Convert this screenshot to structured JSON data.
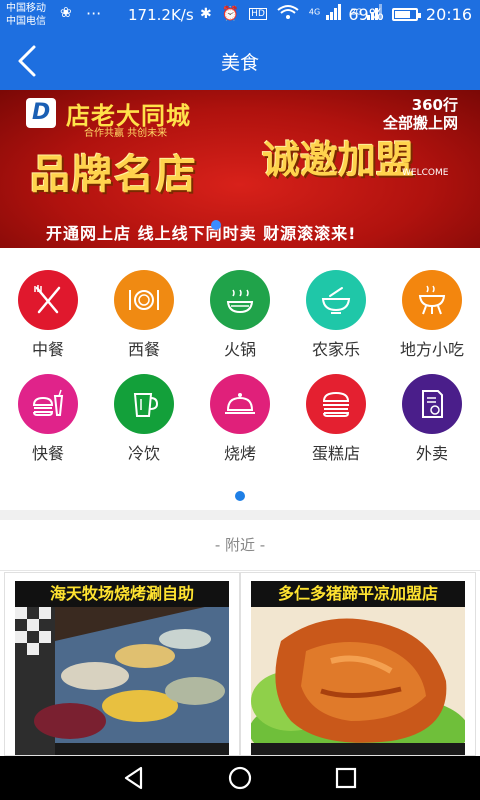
{
  "status_bar": {
    "carrier_1": "中国移动",
    "carrier_2": "中国电信",
    "overflow": "···",
    "net_speed": "171.2K/s",
    "signal_1_tag": "4G",
    "signal_2_tag": "2G",
    "hd_tag": "HD",
    "battery_percent": "69%",
    "battery_level": 0.69,
    "time": "20:16"
  },
  "nav": {
    "title": "美食",
    "back_icon": "chevron-left-icon"
  },
  "banner": {
    "brand": "店老大同城",
    "slogan": "合作共赢  共创未来",
    "badge_line1": "360行",
    "badge_line2": "全部搬上网",
    "headline_left": "品牌名店",
    "headline_right": "诚邀加盟",
    "welcome": "WELCOME",
    "tagline": "开通网上店  线上线下同时卖  财源滚滚来!"
  },
  "categories": [
    {
      "label": "中餐",
      "icon": "fork-knife-icon",
      "color": "#e0182d"
    },
    {
      "label": "西餐",
      "icon": "plate-icon",
      "color": "#f08a12"
    },
    {
      "label": "火锅",
      "icon": "hotpot-icon",
      "color": "#20a34a"
    },
    {
      "label": "农家乐",
      "icon": "bowl-icon",
      "color": "#1fc7a8"
    },
    {
      "label": "地方小吃",
      "icon": "grill-icon",
      "color": "#f3860e"
    },
    {
      "label": "快餐",
      "icon": "burger-drink-icon",
      "color": "#e0238a"
    },
    {
      "label": "冷饮",
      "icon": "cup-icon",
      "color": "#13a03a"
    },
    {
      "label": "烧烤",
      "icon": "cloche-icon",
      "color": "#e0207a"
    },
    {
      "label": "蛋糕店",
      "icon": "cake-icon",
      "color": "#e42030"
    },
    {
      "label": "外卖",
      "icon": "menu-icon",
      "color": "#4a1e8a"
    }
  ],
  "section": {
    "nearby_label": "-   附近   -"
  },
  "shops": [
    {
      "name": "海天牧场烧烤涮自助"
    },
    {
      "name": "多仁多猪蹄平凉加盟店"
    }
  ],
  "colors": {
    "primary": "#1e6fe0",
    "banner_red": "#c4160f",
    "indicator": "#1e7fe6"
  }
}
